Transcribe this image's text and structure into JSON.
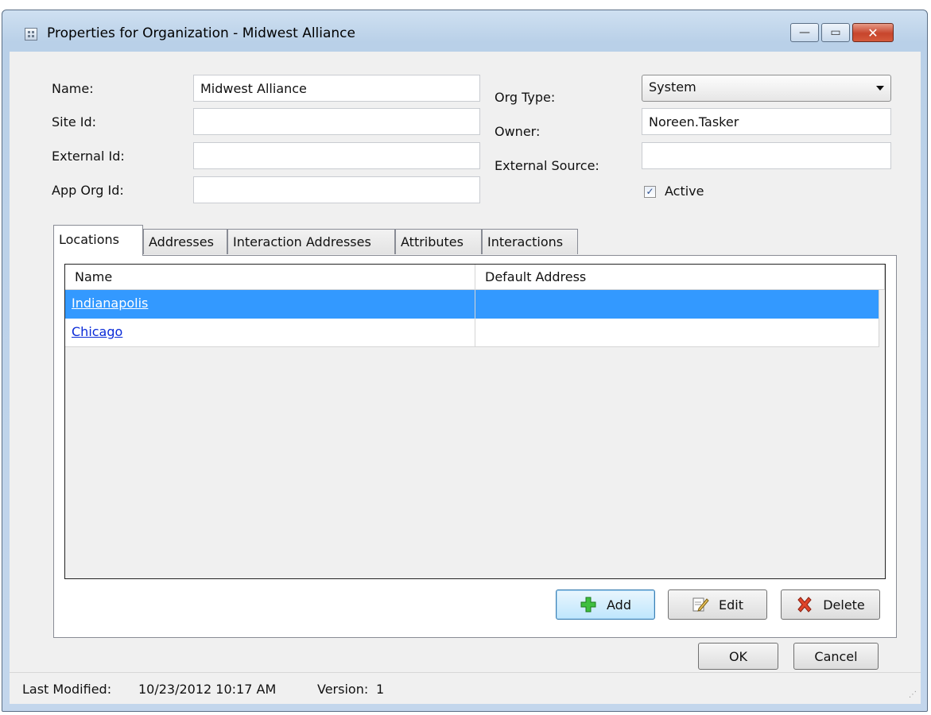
{
  "window": {
    "title": "Properties for Organization - Midwest Alliance",
    "controls": {
      "minimize": "—",
      "maximize": "▭",
      "close": "✕"
    }
  },
  "form": {
    "name": {
      "label": "Name:",
      "value": "Midwest Alliance"
    },
    "site_id": {
      "label": "Site Id:",
      "value": ""
    },
    "external_id": {
      "label": "External Id:",
      "value": ""
    },
    "app_org_id": {
      "label": "App Org Id:",
      "value": ""
    },
    "org_type": {
      "label": "Org Type:",
      "value": "System"
    },
    "owner": {
      "label": "Owner:",
      "value": "Noreen.Tasker"
    },
    "external_source": {
      "label": "External Source:",
      "value": ""
    },
    "active": {
      "label": "Active",
      "checked": true,
      "check_glyph": "✓"
    }
  },
  "tabs": [
    {
      "label": "Locations",
      "active": true
    },
    {
      "label": "Addresses",
      "active": false
    },
    {
      "label": "Interaction Addresses",
      "active": false
    },
    {
      "label": "Attributes",
      "active": false
    },
    {
      "label": "Interactions",
      "active": false
    }
  ],
  "grid": {
    "columns": [
      "Name",
      "Default Address"
    ],
    "rows": [
      {
        "name": "Indianapolis",
        "default_address": "",
        "selected": true
      },
      {
        "name": "Chicago",
        "default_address": "",
        "selected": false
      }
    ]
  },
  "actions": {
    "add": "Add",
    "edit": "Edit",
    "delete": "Delete"
  },
  "dialog_buttons": {
    "ok": "OK",
    "cancel": "Cancel"
  },
  "status": {
    "last_modified_label": "Last Modified:",
    "last_modified_value": "10/23/2012 10:17 AM",
    "version_label": "Version:",
    "version_value": "1"
  },
  "icons": {
    "app": "grid-icon",
    "add": "green-plus-icon",
    "edit": "edit-note-icon",
    "delete": "red-x-icon"
  },
  "colors": {
    "selection": "#3399ff",
    "link": "#0a2bd8",
    "titlebar": "#c3d6ec",
    "close_button": "#c7452c"
  }
}
